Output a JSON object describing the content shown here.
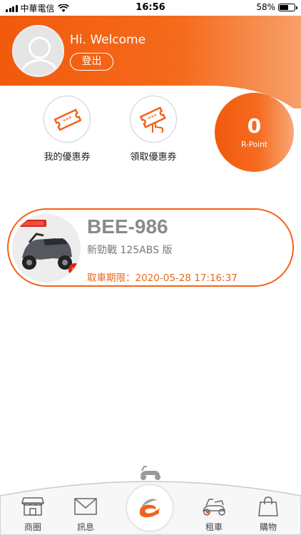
{
  "status_bar": {
    "carrier": "中華電信",
    "time": "16:56",
    "battery": "58%",
    "battery_level": 0.58
  },
  "header": {
    "greeting": "Hi. Welcome",
    "logout_label": "登出"
  },
  "coupons": [
    {
      "label": "我的優惠券",
      "icon": "ticket-icon"
    },
    {
      "label": "領取優惠券",
      "icon": "ticket-hand-icon"
    }
  ],
  "rpoint": {
    "value": "0",
    "label": "R-Point"
  },
  "rental": {
    "plate": "BEE-986",
    "model": "新勁戰 125ABS 版",
    "deadline": "取車期限：2020-05-28 17:16:37"
  },
  "bottom_nav": [
    {
      "label": "商圈",
      "icon": "shop-icon"
    },
    {
      "label": "訊息",
      "icon": "mail-icon"
    },
    {
      "label": "",
      "icon": "app-logo-icon"
    },
    {
      "label": "租車",
      "icon": "scooter-icon"
    },
    {
      "label": "購物",
      "icon": "shopping-bag-icon"
    }
  ],
  "colors": {
    "brand_orange": "#f25a0d",
    "deadline_text": "#e4691d"
  }
}
